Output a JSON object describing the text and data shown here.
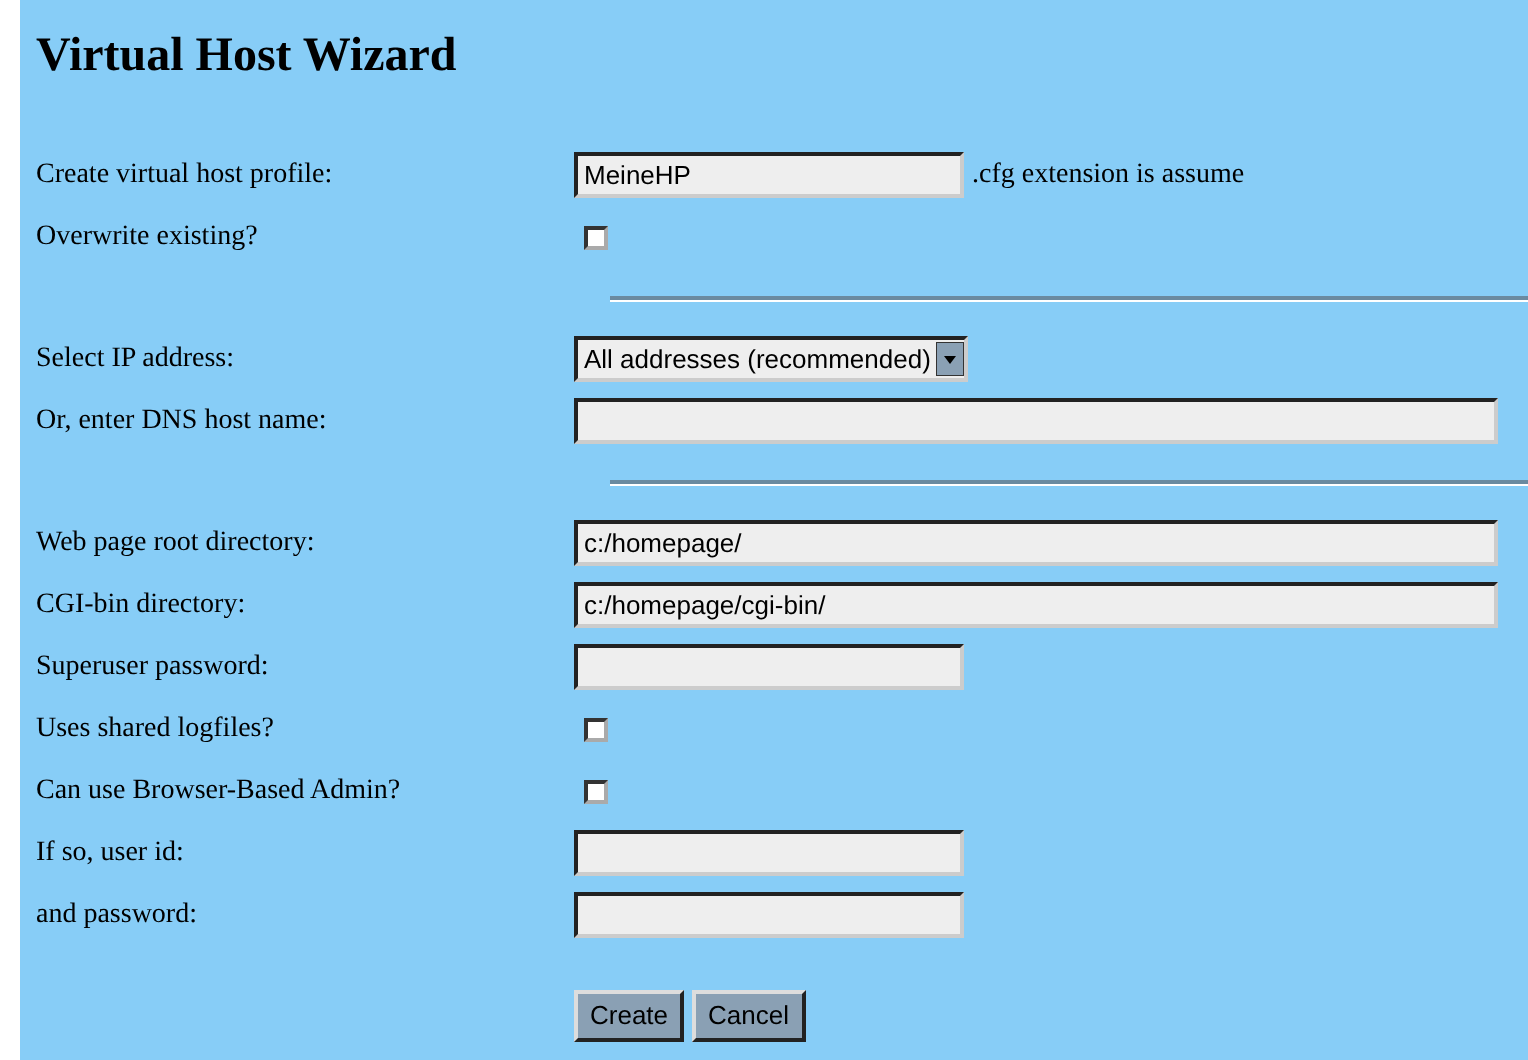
{
  "title": "Virtual Host Wizard",
  "rows": [
    {
      "kind": "text",
      "label": "Create virtual host profile:",
      "value": "MeineHP",
      "wide": false,
      "note": ".cfg extension is assume"
    },
    {
      "kind": "checkbox",
      "label": "Overwrite existing?",
      "checked": false
    },
    {
      "kind": "divider"
    },
    {
      "kind": "select",
      "label": "Select IP address:",
      "value": "All addresses (recommended)"
    },
    {
      "kind": "text",
      "label": "Or, enter DNS host name:",
      "value": "",
      "wide": true
    },
    {
      "kind": "divider"
    },
    {
      "kind": "text",
      "label": "Web page root directory:",
      "value": "c:/homepage/",
      "wide": true
    },
    {
      "kind": "text",
      "label": "CGI-bin directory:",
      "value": "c:/homepage/cgi-bin/",
      "wide": true
    },
    {
      "kind": "text",
      "label": "Superuser password:",
      "value": "",
      "wide": false
    },
    {
      "kind": "checkbox",
      "label": "Uses shared logfiles?",
      "checked": false
    },
    {
      "kind": "checkbox",
      "label": "Can use Browser-Based Admin?",
      "checked": false
    },
    {
      "kind": "text",
      "label": "If so, user id:",
      "value": "",
      "wide": false
    },
    {
      "kind": "text",
      "label": "and password:",
      "value": "",
      "wide": false
    }
  ],
  "buttons": [
    "Create",
    "Cancel"
  ]
}
